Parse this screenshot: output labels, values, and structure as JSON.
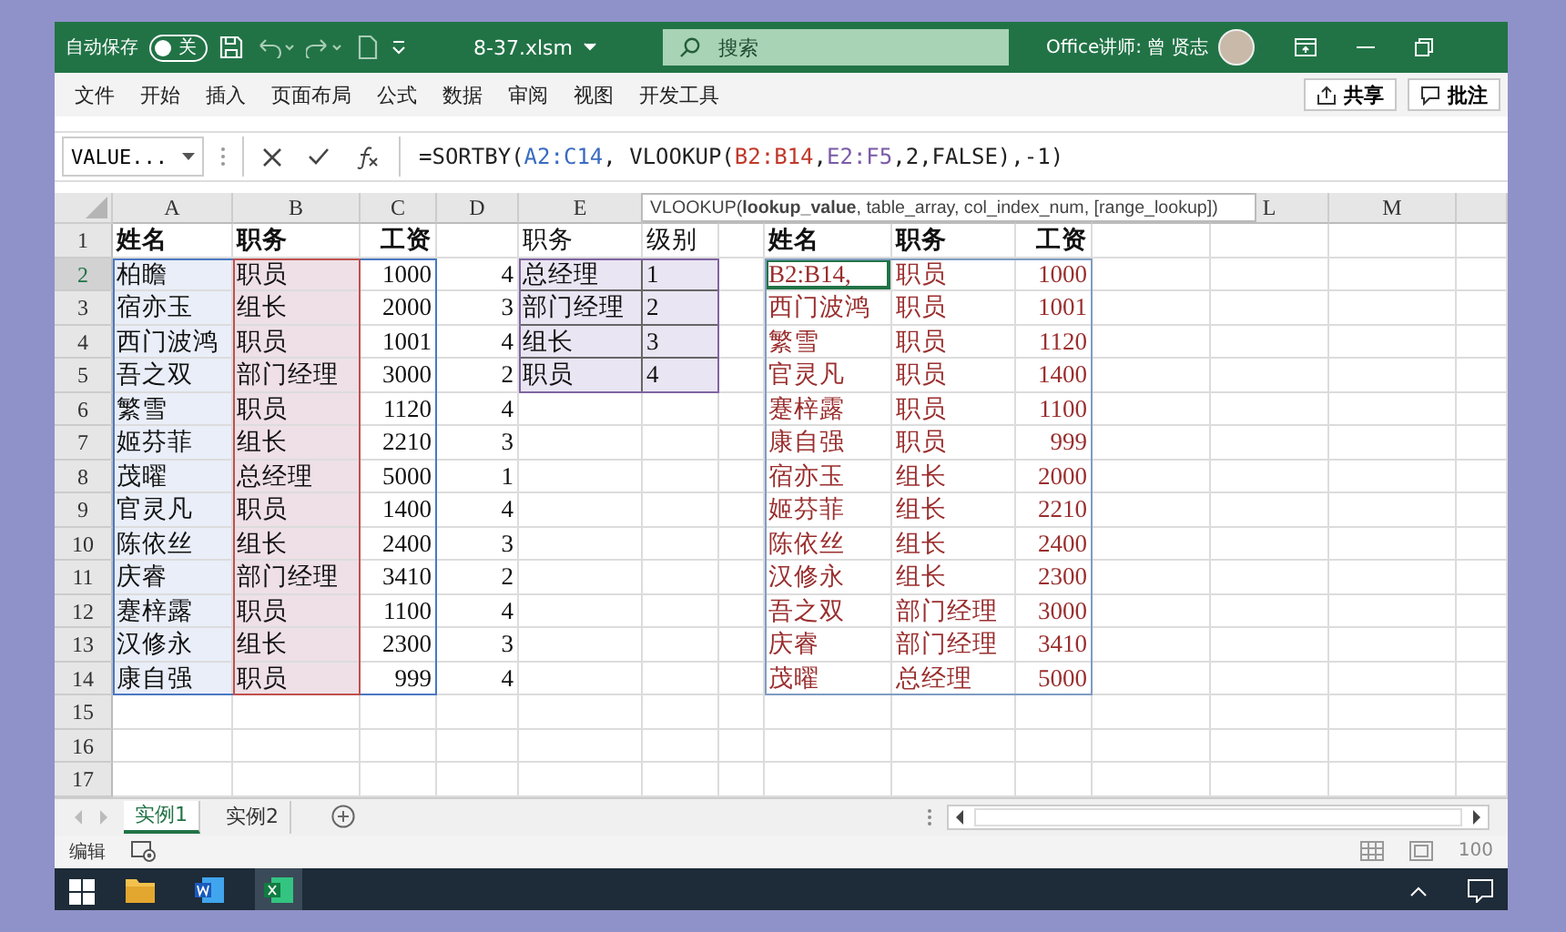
{
  "title_bar": {
    "autosave_label": "自动保存",
    "autosave": {
      "on": false,
      "label": "关"
    },
    "file_name": "8-37.xlsm",
    "search_placeholder": "搜索",
    "user": "Office讲师: 曾 贤志"
  },
  "ribbon_tabs": [
    "文件",
    "开始",
    "插入",
    "页面布局",
    "公式",
    "数据",
    "审阅",
    "视图",
    "开发工具"
  ],
  "ribbon_actions": [
    "共享",
    "批注"
  ],
  "formula_bar": {
    "name_box": "VALUE...",
    "formula": [
      {
        "text": "=SORTBY(",
        "color": "#222222"
      },
      {
        "text": "A2:C14",
        "color": "#3a6cc0"
      },
      {
        "text": ", VLOOKUP(",
        "color": "#222222"
      },
      {
        "text": "B2:B14",
        "color": "#c0392b"
      },
      {
        "text": ",",
        "color": "#222222"
      },
      {
        "text": "E2:F5",
        "color": "#7a5aa8"
      },
      {
        "text": ",2,FALSE),-1)",
        "color": "#222222"
      }
    ]
  },
  "tooltip": "VLOOKUP(**lookup_value**, table_array, col_index_num, [range_lookup])",
  "sheet": {
    "columns": [
      {
        "label": "A"
      },
      {
        "label": "B"
      },
      {
        "label": "C"
      },
      {
        "label": "D"
      },
      {
        "label": "E"
      },
      {},
      {},
      {},
      {},
      {},
      {},
      {
        "label": "L"
      },
      {
        "label": "M"
      },
      {}
    ],
    "row_numbers": [
      "1",
      "2",
      "3",
      "4",
      "5",
      "6",
      "7",
      "8",
      "9",
      "10",
      "11",
      "12",
      "13",
      "14",
      "15",
      "16",
      "17"
    ],
    "source_table": {
      "header": [
        "姓名",
        "职务",
        "工资"
      ],
      "rows": [
        [
          "柏瞻",
          "职员",
          "1000"
        ],
        [
          "宿亦玉",
          "组长",
          "2000"
        ],
        [
          "西门波鸿",
          "职员",
          "1001"
        ],
        [
          "吾之双",
          "部门经理",
          "3000"
        ],
        [
          "繁雪",
          "职员",
          "1120"
        ],
        [
          "姬芬菲",
          "组长",
          "2210"
        ],
        [
          "茂曜",
          "总经理",
          "5000"
        ],
        [
          "官灵凡",
          "职员",
          "1400"
        ],
        [
          "陈依丝",
          "组长",
          "2400"
        ],
        [
          "庆睿",
          "部门经理",
          "3410"
        ],
        [
          "蹇梓露",
          "职员",
          "1100"
        ],
        [
          "汉修永",
          "组长",
          "2300"
        ],
        [
          "康自强",
          "职员",
          "999"
        ]
      ]
    },
    "level_column": [
      "4",
      "3",
      "4",
      "2",
      "4",
      "3",
      "1",
      "4",
      "3",
      "2",
      "4",
      "3",
      "4"
    ],
    "level_table": {
      "header": [
        "职务",
        "级别"
      ],
      "rows": [
        [
          "总经理",
          "1"
        ],
        [
          "部门经理",
          "2"
        ],
        [
          "组长",
          "3"
        ],
        [
          "职员",
          "4"
        ]
      ]
    },
    "result_table": {
      "header": [
        "姓名",
        "职务",
        "工资"
      ],
      "rows": [
        {
          "cells": [
            "B2:B14,",
            "职员",
            "1000"
          ],
          "selected": true
        },
        {
          "cells": [
            "西门波鸿",
            "职员",
            "1001"
          ],
          "selected": false
        },
        {
          "cells": [
            "繁雪",
            "职员",
            "1120"
          ],
          "selected": false
        },
        {
          "cells": [
            "官灵凡",
            "职员",
            "1400"
          ],
          "selected": false
        },
        {
          "cells": [
            "蹇梓露",
            "职员",
            "1100"
          ],
          "selected": false
        },
        {
          "cells": [
            "康自强",
            "职员",
            "999"
          ],
          "selected": false
        },
        {
          "cells": [
            "宿亦玉",
            "组长",
            "2000"
          ],
          "selected": false
        },
        {
          "cells": [
            "姬芬菲",
            "组长",
            "2210"
          ],
          "selected": false
        },
        {
          "cells": [
            "陈依丝",
            "组长",
            "2400"
          ],
          "selected": false
        },
        {
          "cells": [
            "汉修永",
            "组长",
            "2300"
          ],
          "selected": false
        },
        {
          "cells": [
            "吾之双",
            "部门经理",
            "3000"
          ],
          "selected": false
        },
        {
          "cells": [
            "庆睿",
            "部门经理",
            "3410"
          ],
          "selected": false
        },
        {
          "cells": [
            "茂曜",
            "总经理",
            "5000"
          ],
          "selected": false
        }
      ]
    }
  },
  "sheet_tabs": [
    {
      "label": "实例1",
      "selected": true
    },
    {
      "label": "实例2",
      "selected": false
    }
  ],
  "status_bar": {
    "mode": "编辑",
    "zoom": "100"
  },
  "taskbar": {
    "apps": [
      {
        "kind": "explorer",
        "selected": false
      },
      {
        "kind": "word",
        "selected": false
      },
      {
        "kind": "excel",
        "selected": true
      }
    ]
  }
}
